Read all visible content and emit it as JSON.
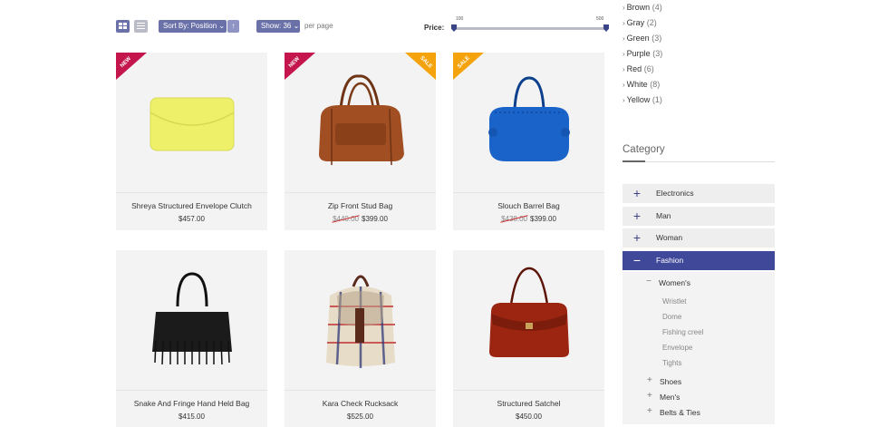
{
  "toolbar": {
    "sort_label": "Sort By: Position ⌄",
    "direction_icon": "arrow-up-icon",
    "show_label": "Show: 36 ⌄",
    "per_page": "per page",
    "price_label": "Price:",
    "price_min": "100",
    "price_max": "500",
    "price_range_fraction": [
      0,
      1
    ]
  },
  "products": [
    {
      "name": "Shreya Structured Envelope Clutch",
      "price": "$457.00",
      "old_price": "",
      "ribbon": "NEW",
      "image_icon": "yellow-clutch"
    },
    {
      "name": "Zip Front Stud Bag",
      "price": "$399.00",
      "old_price": "$440.00",
      "ribbon_left": "NEW",
      "ribbon_right": "SALE",
      "image_icon": "brown-duffle"
    },
    {
      "name": "Slouch Barrel Bag",
      "price": "$399.00",
      "old_price": "$438.00",
      "ribbon": "SALE",
      "image_icon": "blue-barrel-bag"
    },
    {
      "name": "Snake And Fringe Hand Held Bag",
      "price": "$415.00",
      "old_price": "",
      "image_icon": "black-fringe-bag"
    },
    {
      "name": "Kara Check Rucksack",
      "price": "$525.00",
      "old_price": "",
      "image_icon": "plaid-rucksack"
    },
    {
      "name": "Structured Satchel",
      "price": "$450.00",
      "old_price": "",
      "image_icon": "red-satchel"
    }
  ],
  "colors_filter": [
    {
      "label": "Brown",
      "count": "(4)"
    },
    {
      "label": "Gray",
      "count": "(2)"
    },
    {
      "label": "Green",
      "count": "(3)"
    },
    {
      "label": "Purple",
      "count": "(3)"
    },
    {
      "label": "Red",
      "count": "(6)"
    },
    {
      "label": "White",
      "count": "(8)"
    },
    {
      "label": "Yellow",
      "count": "(1)"
    }
  ],
  "category": {
    "title": "Category",
    "items": [
      "Electronics",
      "Man",
      "Woman",
      "Fashion"
    ],
    "active": "Fashion",
    "sub": {
      "label": "Women's",
      "children": [
        "Wristlet",
        "Dome",
        "Fishing creel",
        "Envelope",
        "Tights"
      ]
    },
    "more": [
      "Shoes",
      "Men's",
      "Belts & Ties"
    ]
  },
  "colors": {
    "accent": "#40489a",
    "button": "#6a71a8",
    "new": "#c4154d",
    "sale": "#f5a30c"
  }
}
